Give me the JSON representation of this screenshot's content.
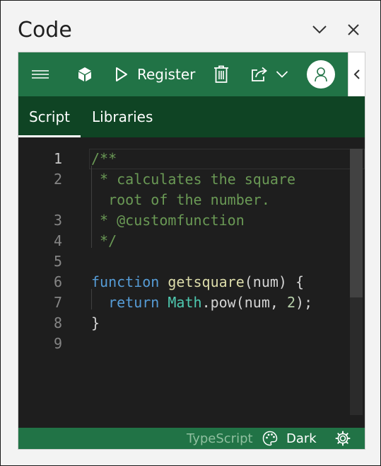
{
  "pane": {
    "title": "Code"
  },
  "toolbar": {
    "register_label": "Register"
  },
  "tabs": [
    {
      "label": "Script"
    },
    {
      "label": "Libraries"
    }
  ],
  "editor": {
    "lines": [
      {
        "num": "1",
        "tokens": [
          {
            "t": "/**",
            "c": "comment"
          }
        ]
      },
      {
        "num": "2",
        "tokens": [
          {
            "t": " * calculates the square",
            "c": "comment"
          }
        ]
      },
      {
        "num": "",
        "tokens": [
          {
            "t": "  root of the number.",
            "c": "comment"
          }
        ]
      },
      {
        "num": "3",
        "tokens": [
          {
            "t": " * @customfunction",
            "c": "comment"
          }
        ]
      },
      {
        "num": "4",
        "tokens": [
          {
            "t": " */",
            "c": "comment"
          }
        ]
      },
      {
        "num": "5",
        "tokens": []
      },
      {
        "num": "6",
        "tokens": [
          {
            "t": "function",
            "c": "kw"
          },
          {
            "t": " ",
            "c": ""
          },
          {
            "t": "getsquare",
            "c": "fn"
          },
          {
            "t": "(num) {",
            "c": ""
          }
        ]
      },
      {
        "num": "7",
        "tokens": [
          {
            "t": "  ",
            "c": ""
          },
          {
            "t": "return",
            "c": "kw"
          },
          {
            "t": " ",
            "c": ""
          },
          {
            "t": "Math",
            "c": "type"
          },
          {
            "t": ".pow(num, ",
            "c": ""
          },
          {
            "t": "2",
            "c": "num"
          },
          {
            "t": ");",
            "c": ""
          }
        ]
      },
      {
        "num": "8",
        "tokens": [
          {
            "t": "}",
            "c": ""
          }
        ]
      },
      {
        "num": "9",
        "tokens": []
      }
    ]
  },
  "status": {
    "language": "TypeScript",
    "theme": "Dark"
  },
  "colors": {
    "toolbar_green": "#217346",
    "tab_bar_green": "#0f4424",
    "editor_bg": "#1e1e1e"
  }
}
